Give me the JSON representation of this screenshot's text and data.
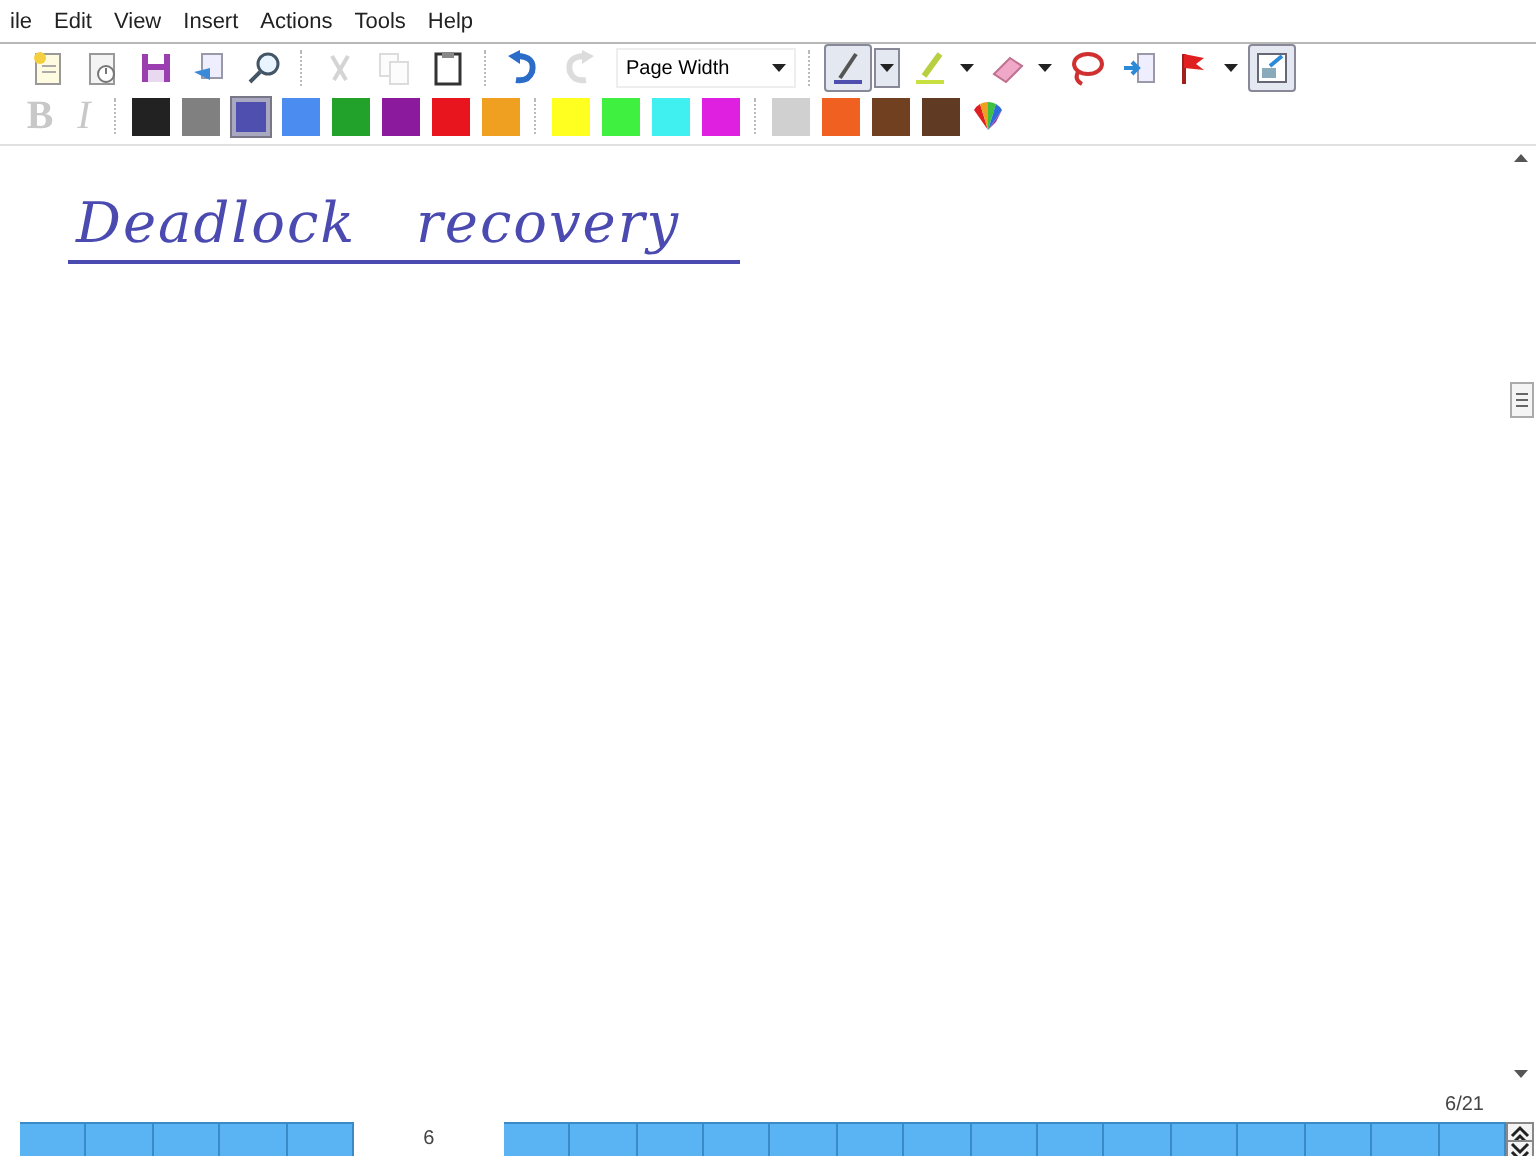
{
  "menu": [
    "ile",
    "Edit",
    "View",
    "Insert",
    "Actions",
    "Tools",
    "Help"
  ],
  "toolbar": [
    {
      "kind": "new-note",
      "disabled": false
    },
    {
      "kind": "template",
      "disabled": false
    },
    {
      "kind": "save",
      "disabled": false
    },
    {
      "kind": "send",
      "disabled": false
    },
    {
      "kind": "find",
      "disabled": false
    },
    {
      "kind": "separator"
    },
    {
      "kind": "cut",
      "disabled": true
    },
    {
      "kind": "copy",
      "disabled": true
    },
    {
      "kind": "paste",
      "disabled": false
    },
    {
      "kind": "separator"
    },
    {
      "kind": "undo",
      "disabled": false
    },
    {
      "kind": "redo",
      "disabled": true
    },
    {
      "kind": "zoom",
      "value": "Page Width"
    },
    {
      "kind": "separator"
    },
    {
      "kind": "pen",
      "selected": true,
      "dropdown": true
    },
    {
      "kind": "highlighter",
      "selected": false,
      "dropdown": true
    },
    {
      "kind": "eraser",
      "selected": false,
      "dropdown": true
    },
    {
      "kind": "lasso",
      "selected": false,
      "dropdown": false
    },
    {
      "kind": "insert-space",
      "selected": false,
      "dropdown": false
    },
    {
      "kind": "flag",
      "selected": false,
      "dropdown": true
    },
    {
      "kind": "view-toggle",
      "selected": true,
      "dropdown": false
    }
  ],
  "format": [
    {
      "kind": "bold",
      "label": "B",
      "disabled": true
    },
    {
      "kind": "italic",
      "label": "I",
      "disabled": true
    }
  ],
  "colors": [
    {
      "color": "#222222",
      "selected": false
    },
    {
      "color": "#808080",
      "selected": false
    },
    {
      "color": "#4f4fb0",
      "selected": true
    },
    {
      "color": "#4a8cf0",
      "selected": false
    },
    {
      "color": "#22a22a",
      "selected": false
    },
    {
      "color": "#8c1a9c",
      "selected": false
    },
    {
      "color": "#e8141e",
      "selected": false
    },
    {
      "color": "#f0a020",
      "selected": false
    },
    {
      "color": "#ffff20",
      "selected": false,
      "group_start": true
    },
    {
      "color": "#40f040",
      "selected": false
    },
    {
      "color": "#40f0f0",
      "selected": false
    },
    {
      "color": "#e020e0",
      "selected": false
    },
    {
      "color": "#d0d0d0",
      "selected": false,
      "group_start": true
    },
    {
      "color": "#f06020",
      "selected": false
    },
    {
      "color": "#704020",
      "selected": false
    },
    {
      "color": "#603a22",
      "selected": false
    }
  ],
  "note": {
    "heading": "Deadlock recovery"
  },
  "page_indicator": "6/21",
  "current_page": "6",
  "pages": [
    {
      "selected": false
    },
    {
      "selected": false
    },
    {
      "selected": false
    },
    {
      "selected": false
    },
    {
      "selected": false
    },
    {
      "selected": true
    },
    {
      "selected": false
    },
    {
      "selected": false
    },
    {
      "selected": false
    },
    {
      "selected": false
    },
    {
      "selected": false
    },
    {
      "selected": false
    },
    {
      "selected": false
    },
    {
      "selected": false
    },
    {
      "selected": false
    },
    {
      "selected": false
    },
    {
      "selected": false
    },
    {
      "selected": false
    },
    {
      "selected": false
    },
    {
      "selected": false
    },
    {
      "selected": false
    }
  ]
}
